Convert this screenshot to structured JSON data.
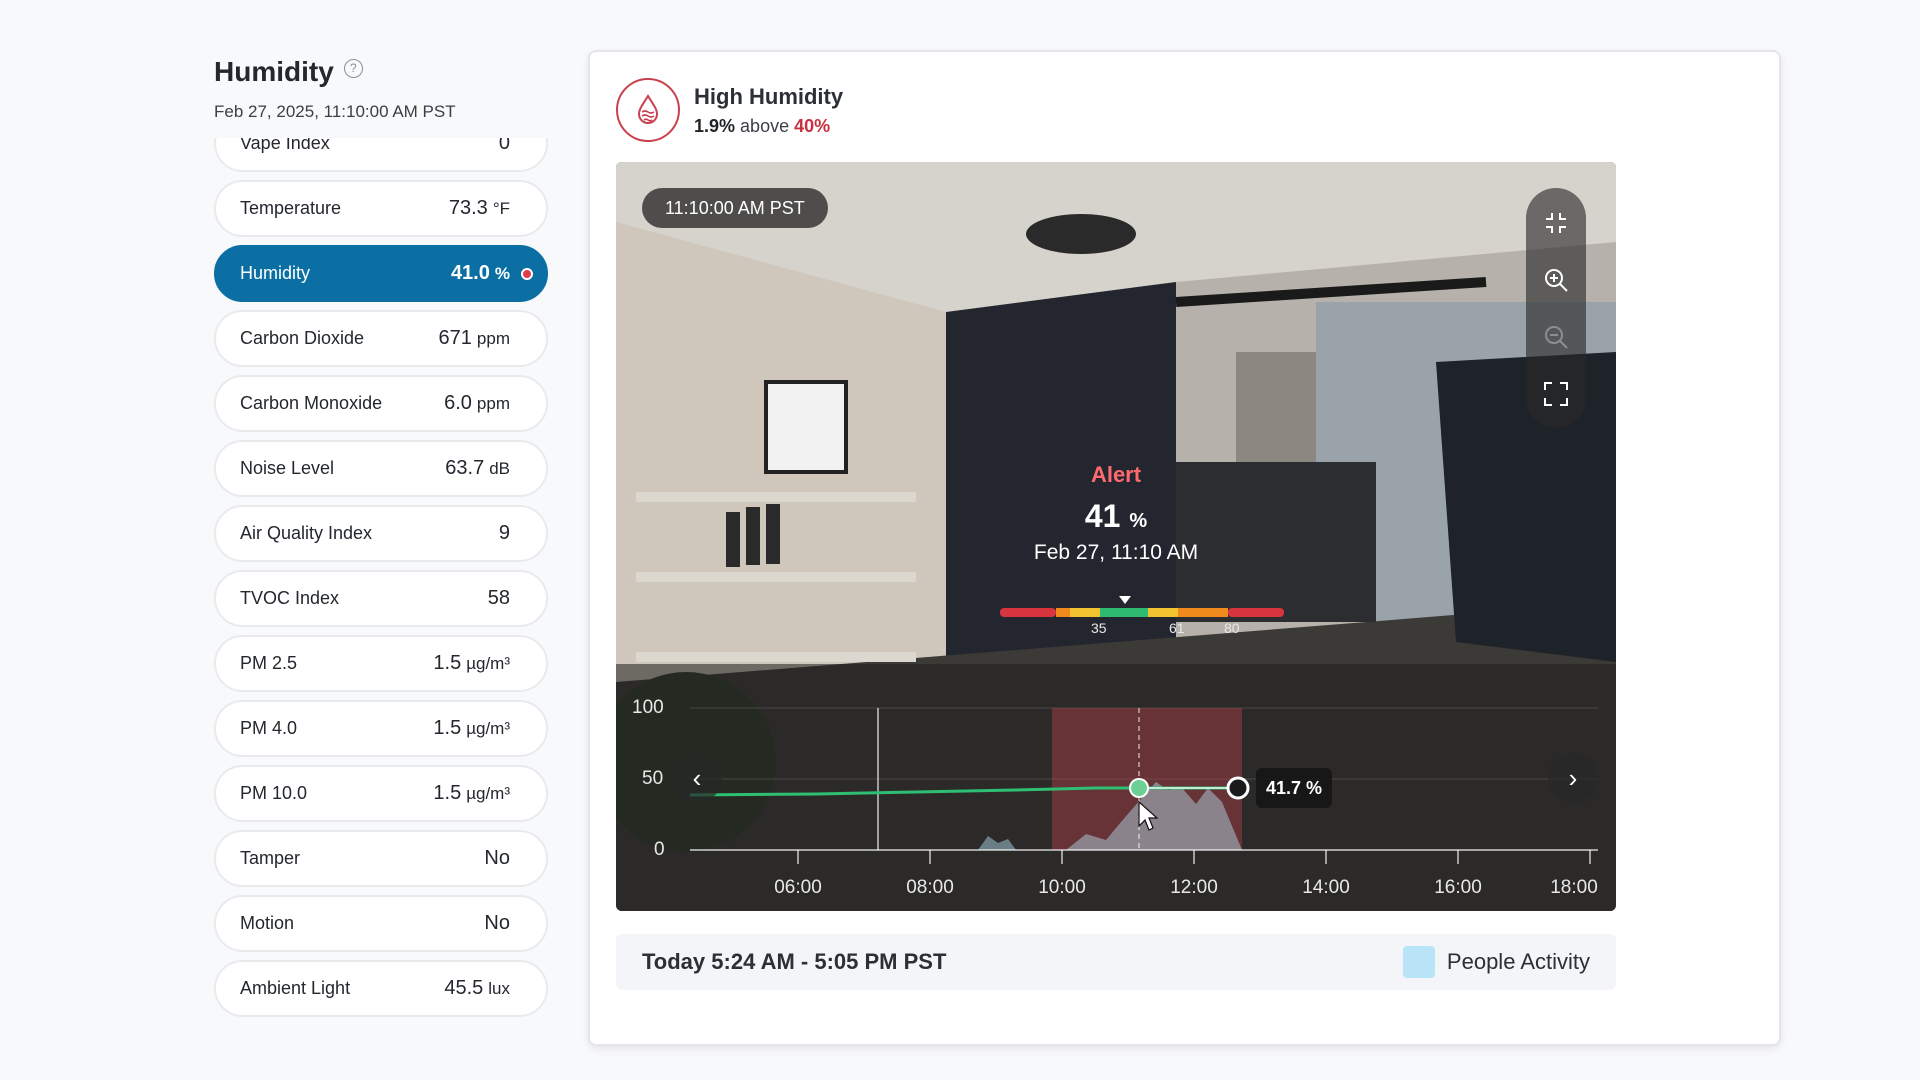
{
  "panel": {
    "title": "Humidity",
    "help_icon": "question-circle-icon",
    "timestamp": "Feb 27, 2025, 11:10:00 AM PST",
    "readings": [
      {
        "label": "Vape Index",
        "value": "0",
        "unit": ""
      },
      {
        "label": "Temperature",
        "value": "73.3",
        "unit": "°F"
      },
      {
        "label": "Humidity",
        "value": "41.0",
        "unit": "%",
        "active": true,
        "alert": true
      },
      {
        "label": "Carbon Dioxide",
        "value": "671",
        "unit": "ppm"
      },
      {
        "label": "Carbon Monoxide",
        "value": "6.0",
        "unit": "ppm"
      },
      {
        "label": "Noise Level",
        "value": "63.7",
        "unit": "dB"
      },
      {
        "label": "Air Quality Index",
        "value": "9",
        "unit": ""
      },
      {
        "label": "TVOC Index",
        "value": "58",
        "unit": ""
      },
      {
        "label": "PM 2.5",
        "value": "1.5",
        "unit": "µg/m³"
      },
      {
        "label": "PM 4.0",
        "value": "1.5",
        "unit": "µg/m³"
      },
      {
        "label": "PM 10.0",
        "value": "1.5",
        "unit": "µg/m³"
      },
      {
        "label": "Tamper",
        "value": "No",
        "unit": ""
      },
      {
        "label": "Motion",
        "value": "No",
        "unit": ""
      },
      {
        "label": "Ambient Light",
        "value": "45.5",
        "unit": "lux"
      }
    ]
  },
  "alert": {
    "icon": "humidity-drop-icon",
    "title": "High Humidity",
    "amount": "1.9%",
    "above_word": "above",
    "threshold": "40%",
    "color": "#c9303f"
  },
  "video": {
    "time_label": "11:10:00 AM PST",
    "tools": [
      "exit-fullscreen-icon",
      "zoom-in-icon",
      "zoom-out-icon",
      "fullscreen-icon"
    ],
    "overlay": {
      "alert_word": "Alert",
      "value": "41",
      "unit": "%",
      "date": "Feb 27, 11:10 AM",
      "scale_ticks": [
        "35",
        "61",
        "80"
      ]
    }
  },
  "chart": {
    "y_ticks": [
      "100",
      "50",
      "0"
    ],
    "x_ticks": [
      "06:00",
      "08:00",
      "10:00",
      "12:00",
      "14:00",
      "16:00",
      "18:00"
    ],
    "hover_value": "41.7 %",
    "prev_icon": "chevron-left-icon",
    "next_icon": "chevron-right-icon"
  },
  "footer": {
    "range": "Today 5:24 AM - 5:05 PM PST",
    "legend_label": "People Activity",
    "legend_color": "#b9e4f7"
  }
}
